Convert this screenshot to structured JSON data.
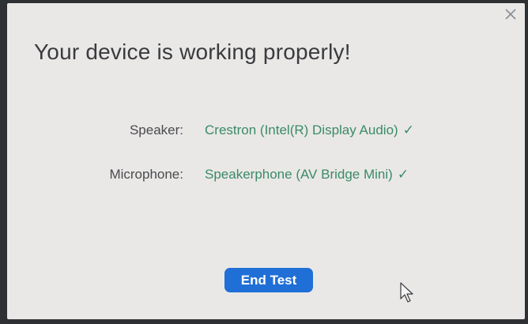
{
  "dialog": {
    "title": "Your device is working properly!",
    "close_icon": "close-icon",
    "speaker": {
      "label": "Speaker:",
      "value": "Crestron (Intel(R) Display Audio)",
      "status_icon": "checkmark-icon"
    },
    "microphone": {
      "label": "Microphone:",
      "value": "Speakerphone (AV Bridge Mini)",
      "status_icon": "checkmark-icon"
    },
    "end_test_label": "End Test"
  },
  "colors": {
    "accent": "#1f6fd6",
    "success": "#3b8a6a",
    "dialog_background": "#e9e8e6"
  }
}
